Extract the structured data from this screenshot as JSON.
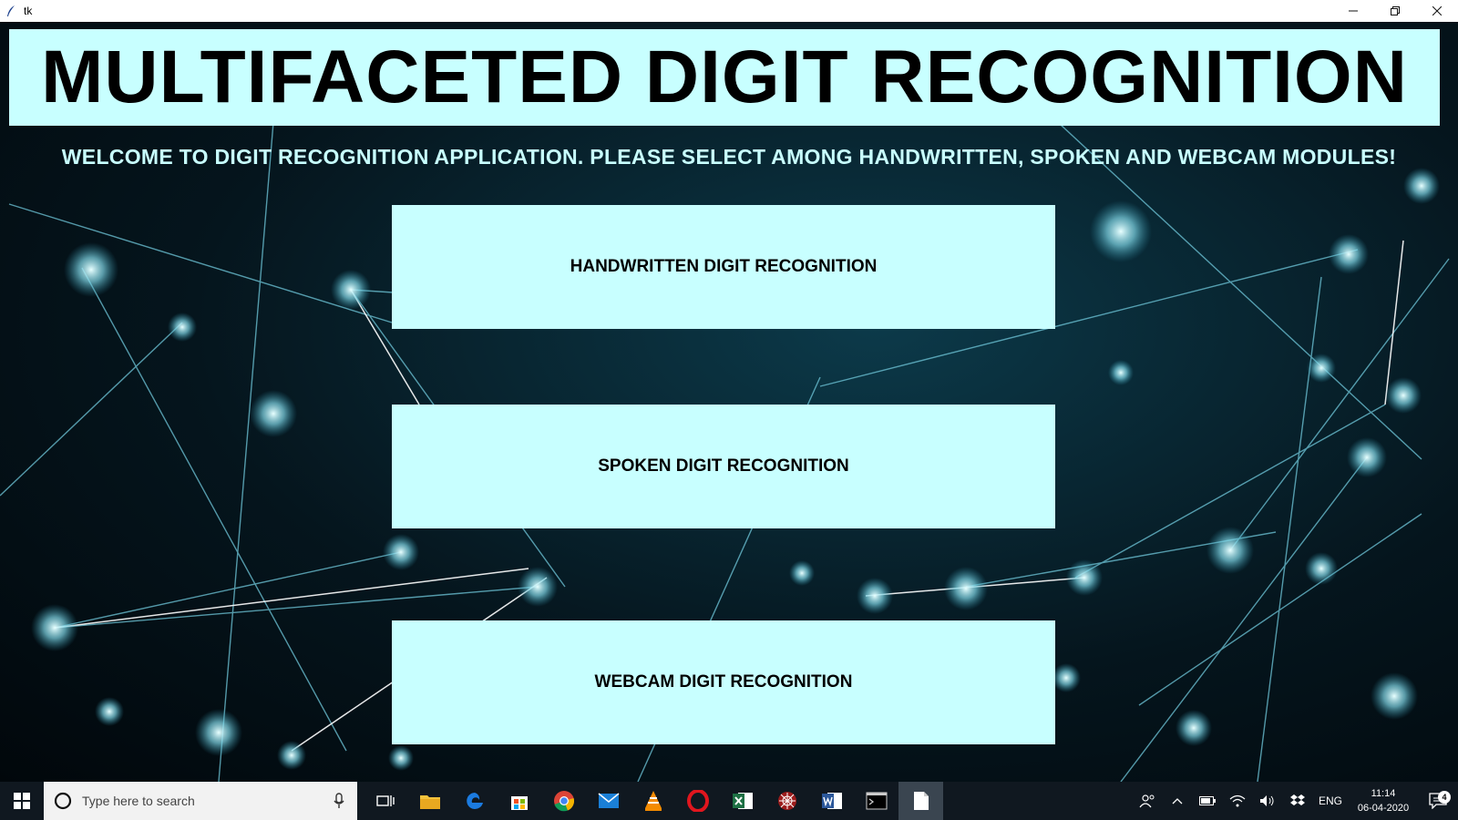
{
  "window": {
    "title": "tk",
    "minimize_icon": "minimize-icon",
    "restore_icon": "restore-icon",
    "close_icon": "close-icon"
  },
  "app": {
    "heading": "MULTIFACETED DIGIT RECOGNITION",
    "subtitle": "WELCOME TO DIGIT RECOGNITION APPLICATION. PLEASE SELECT AMONG HANDWRITTEN, SPOKEN AND WEBCAM MODULES!",
    "buttons": [
      {
        "label": "HANDWRITTEN DIGIT RECOGNITION"
      },
      {
        "label": "SPOKEN DIGIT RECOGNITION"
      },
      {
        "label": "WEBCAM DIGIT RECOGNITION"
      }
    ],
    "colors": {
      "panel": "#c8ffff",
      "text": "#000000"
    }
  },
  "taskbar": {
    "search_placeholder": "Type here to search",
    "apps": [
      "task-view-icon",
      "file-explorer-icon",
      "edge-icon",
      "store-icon",
      "chrome-icon",
      "mail-icon",
      "vlc-icon",
      "opera-icon",
      "excel-icon",
      "spider-app-icon",
      "word-icon",
      "terminal-icon",
      "document-icon"
    ],
    "tray": {
      "language": "ENG",
      "time": "11:14",
      "date": "06-04-2020",
      "notification_count": "4"
    }
  }
}
